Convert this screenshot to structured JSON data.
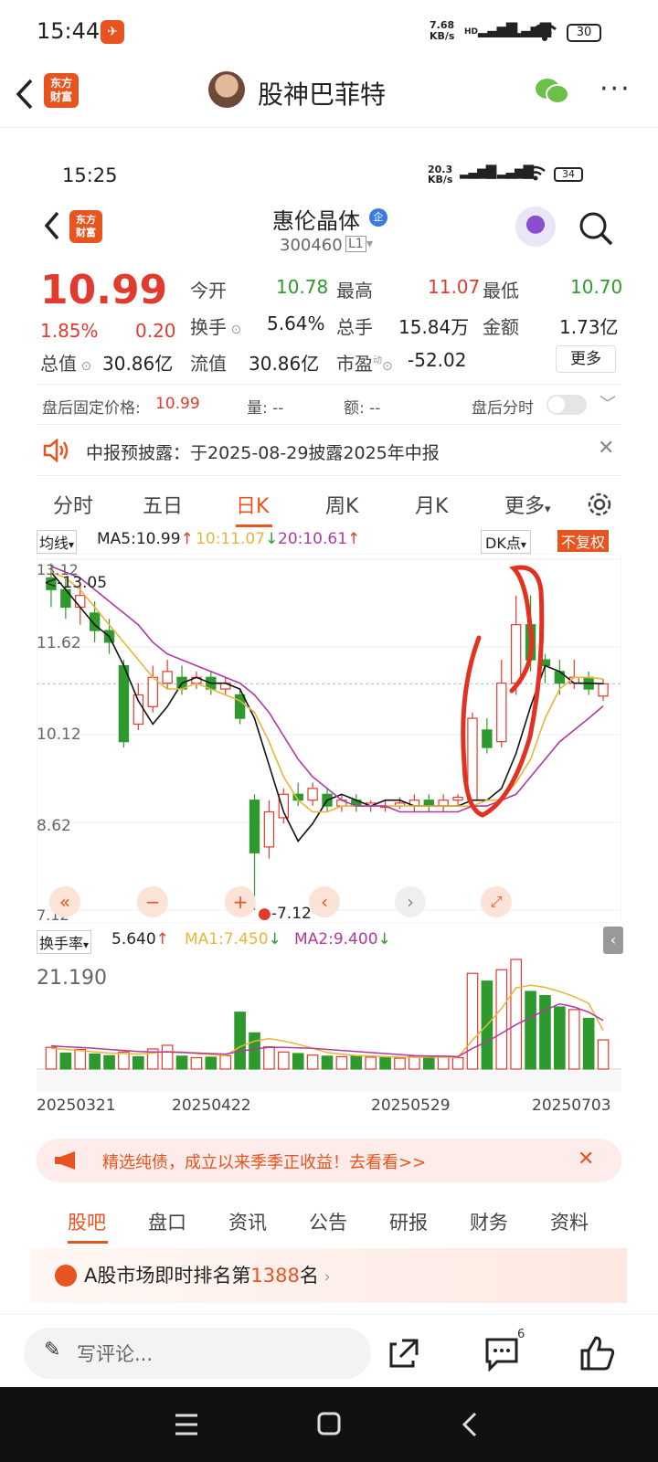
{
  "status": {
    "time": "15:44",
    "speed": "7.68",
    "speed_unit": "KB/s",
    "net1": "HD",
    "net2": "HD",
    "battery": "30"
  },
  "topbar": {
    "app_logo": "东方\n财富",
    "username": "股神巴菲特",
    "more": "···"
  },
  "inner_status": {
    "time": "15:25",
    "speed": "20.3",
    "speed_unit": "KB/s",
    "battery": "34"
  },
  "stock": {
    "name": "惠伦晶体",
    "badge": "企",
    "code": "300460",
    "level": "L1",
    "price": "10.99",
    "change_pct": "1.85%",
    "change": "0.20",
    "open_label": "今开",
    "open": "10.78",
    "high_label": "最高",
    "high": "11.07",
    "low_label": "最低",
    "low": "10.70",
    "turnover_label": "换手",
    "turnover": "5.64%",
    "volume_label": "总手",
    "volume": "15.84万",
    "amount_label": "金额",
    "amount": "1.73亿",
    "mcap_label": "总值",
    "mcap": "30.86亿",
    "float_label": "流值",
    "float": "30.86亿",
    "pe_label": "市盈",
    "pe_sup": "动",
    "pe": "-52.02",
    "more_btn": "更多",
    "after_label": "盘后固定价格:",
    "after_price": "10.99",
    "after_vol_label": "量:",
    "after_vol": "--",
    "after_amt_label": "额:",
    "after_amt": "--",
    "after_toggle": "盘后分时"
  },
  "notice": {
    "text": "中报预披露：于2025-08-29披露2025年中报"
  },
  "chart_tabs": [
    "分时",
    "五日",
    "日K",
    "周K",
    "月K",
    "更多"
  ],
  "ma_bar": {
    "selector": "均线",
    "ma5": "MA5:10.99",
    "ma10": "10:11.07",
    "ma20": "20:10.61",
    "dk": "DK点",
    "fq": "不复权"
  },
  "kline_labels": {
    "top": "13.12",
    "high_mark": "13.05",
    "y2": "11.62",
    "y3": "10.12",
    "y4": "8.62",
    "bottom": "7.12",
    "low_mark": "7.12"
  },
  "vol_bar": {
    "selector": "换手率",
    "value": "5.640",
    "ma1": "MA1:7.450",
    "ma2": "MA2:9.400",
    "max": "21.190"
  },
  "dates": [
    "20250321",
    "20250422",
    "20250529",
    "20250703"
  ],
  "ad": {
    "text": "精选纯债，成立以来季季正收益！去看看>>"
  },
  "bottom_tabs": [
    "股吧",
    "盘口",
    "资讯",
    "公告",
    "研报",
    "财务",
    "资料"
  ],
  "rank": {
    "prefix": "A股市场即时排名第",
    "num": "1388",
    "suffix": "名"
  },
  "comment": {
    "placeholder": "写评论...",
    "count": "6"
  },
  "colors": {
    "up": "#e23b2e",
    "down": "#2e9a2e",
    "accent": "#e8541f",
    "ma5": "#111111",
    "ma10": "#e8b53a",
    "ma20": "#b2399e"
  },
  "chart_data": [
    {
      "type": "candlestick",
      "title": "惠伦晶体 日K",
      "x_start": "20250321",
      "x_end": "20250703",
      "ylim": [
        7.12,
        13.12
      ],
      "y_ticks": [
        13.12,
        11.62,
        10.12,
        8.62,
        7.12
      ],
      "series": [
        {
          "name": "MA5",
          "values": [
            12.9,
            12.6,
            12.3,
            12.0,
            11.8,
            11.3,
            10.7,
            10.3,
            10.6,
            11.0,
            11.1,
            11.0,
            11.0,
            10.9,
            10.4,
            9.6,
            8.8,
            8.3,
            8.6,
            9.0,
            9.1,
            9.0,
            8.9,
            9.0,
            9.0,
            8.9,
            8.9,
            8.9,
            8.9,
            9.0,
            9.0,
            9.2,
            9.8,
            10.6,
            11.3,
            11.2,
            11.0,
            11.0,
            10.99
          ]
        },
        {
          "name": "MA10",
          "values": [
            12.9,
            12.8,
            12.6,
            12.3,
            12.0,
            11.7,
            11.4,
            11.1,
            10.9,
            10.9,
            11.0,
            10.9,
            10.8,
            10.7,
            10.5,
            10.0,
            9.4,
            9.0,
            8.8,
            8.8,
            8.9,
            8.9,
            8.9,
            8.9,
            8.9,
            8.9,
            8.9,
            8.9,
            8.9,
            8.9,
            9.0,
            9.0,
            9.3,
            9.7,
            10.4,
            10.9,
            11.1,
            11.1,
            11.07
          ]
        },
        {
          "name": "MA20",
          "values": [
            13.0,
            12.9,
            12.8,
            12.6,
            12.4,
            12.2,
            12.0,
            11.7,
            11.5,
            11.4,
            11.3,
            11.2,
            11.1,
            11.0,
            10.8,
            10.5,
            10.1,
            9.7,
            9.4,
            9.2,
            9.0,
            8.9,
            8.9,
            8.9,
            8.8,
            8.8,
            8.8,
            8.8,
            8.8,
            8.9,
            8.9,
            9.0,
            9.1,
            9.4,
            9.7,
            10.0,
            10.2,
            10.4,
            10.61
          ]
        }
      ],
      "candles": [
        [
          12.8,
          12.6,
          13.05,
          12.3
        ],
        [
          12.6,
          12.3,
          12.8,
          12.1
        ],
        [
          12.3,
          12.5,
          12.7,
          12.0
        ],
        [
          12.2,
          11.9,
          12.4,
          11.7
        ],
        [
          11.9,
          11.7,
          12.1,
          11.5
        ],
        [
          11.3,
          10.0,
          11.4,
          9.9
        ],
        [
          10.3,
          10.8,
          11.0,
          10.2
        ],
        [
          10.6,
          11.1,
          11.3,
          10.5
        ],
        [
          11.0,
          11.2,
          11.4,
          10.9
        ],
        [
          11.1,
          10.9,
          11.3,
          10.8
        ],
        [
          11.0,
          11.1,
          11.2,
          10.9
        ],
        [
          11.1,
          10.9,
          11.2,
          10.8
        ],
        [
          10.9,
          11.0,
          11.1,
          10.8
        ],
        [
          10.8,
          10.4,
          10.9,
          10.3
        ],
        [
          9.0,
          8.1,
          9.1,
          7.12
        ],
        [
          8.2,
          8.8,
          9.0,
          8.0
        ],
        [
          8.7,
          9.1,
          9.2,
          8.6
        ],
        [
          9.1,
          9.0,
          9.3,
          8.9
        ],
        [
          9.0,
          9.2,
          9.3,
          8.9
        ],
        [
          9.1,
          8.9,
          9.2,
          8.8
        ],
        [
          8.9,
          9.0,
          9.1,
          8.8
        ],
        [
          9.0,
          8.9,
          9.1,
          8.8
        ],
        [
          8.9,
          8.95,
          9.0,
          8.8
        ],
        [
          8.9,
          8.9,
          9.0,
          8.8
        ],
        [
          8.9,
          8.95,
          9.05,
          8.85
        ],
        [
          8.9,
          9.0,
          9.1,
          8.8
        ],
        [
          9.0,
          8.9,
          9.1,
          8.8
        ],
        [
          8.9,
          9.0,
          9.1,
          8.8
        ],
        [
          9.0,
          9.05,
          9.1,
          8.9
        ],
        [
          9.0,
          10.4,
          10.5,
          9.0
        ],
        [
          10.2,
          9.9,
          10.4,
          9.8
        ],
        [
          10.0,
          11.0,
          11.4,
          9.9
        ],
        [
          11.0,
          12.0,
          12.5,
          10.8
        ],
        [
          12.0,
          11.4,
          12.5,
          11.2
        ],
        [
          11.4,
          11.3,
          11.5,
          11.0
        ],
        [
          11.2,
          11.0,
          11.4,
          10.8
        ],
        [
          11.0,
          11.1,
          11.4,
          10.9
        ],
        [
          11.1,
          10.9,
          11.2,
          10.8
        ],
        [
          10.78,
          10.99,
          11.07,
          10.7
        ]
      ]
    },
    {
      "type": "bar",
      "title": "换手率",
      "ylim": [
        0,
        21.19
      ],
      "values": [
        4.2,
        3.1,
        3.8,
        2.9,
        2.6,
        3.3,
        2.4,
        3.9,
        4.6,
        2.5,
        2.2,
        2.3,
        2.6,
        11.0,
        7.0,
        4.3,
        3.3,
        3.0,
        2.7,
        2.5,
        2.4,
        2.6,
        2.3,
        2.2,
        2.1,
        2.5,
        2.3,
        2.4,
        2.2,
        18.5,
        17.0,
        19.2,
        21.19,
        15.0,
        14.2,
        12.0,
        11.5,
        9.8,
        5.64
      ],
      "up": [
        true,
        false,
        true,
        false,
        false,
        true,
        false,
        true,
        true,
        false,
        true,
        false,
        true,
        false,
        false,
        true,
        true,
        false,
        true,
        false,
        true,
        false,
        true,
        false,
        true,
        true,
        false,
        true,
        true,
        true,
        false,
        true,
        true,
        false,
        false,
        false,
        true,
        false,
        true
      ],
      "series": [
        {
          "name": "MA1",
          "values": [
            4.0,
            3.8,
            3.6,
            3.3,
            3.1,
            3.0,
            2.9,
            3.1,
            3.4,
            3.3,
            3.0,
            2.8,
            2.6,
            4.3,
            5.4,
            5.9,
            5.4,
            4.8,
            4.0,
            3.2,
            2.9,
            2.6,
            2.5,
            2.4,
            2.3,
            2.3,
            2.3,
            2.3,
            2.3,
            5.6,
            8.5,
            11.7,
            15.7,
            16.2,
            15.8,
            15.0,
            14.0,
            12.7,
            7.45
          ]
        },
        {
          "name": "MA2",
          "values": [
            4.5,
            4.3,
            4.2,
            4.0,
            3.8,
            3.6,
            3.4,
            3.3,
            3.3,
            3.2,
            3.1,
            3.0,
            2.9,
            3.4,
            3.9,
            4.2,
            4.2,
            4.1,
            4.0,
            3.8,
            3.6,
            3.4,
            3.2,
            3.0,
            2.8,
            2.6,
            2.5,
            2.5,
            2.4,
            4.0,
            5.3,
            6.9,
            8.6,
            10.0,
            11.4,
            12.6,
            12.0,
            11.0,
            9.4
          ]
        }
      ]
    }
  ]
}
